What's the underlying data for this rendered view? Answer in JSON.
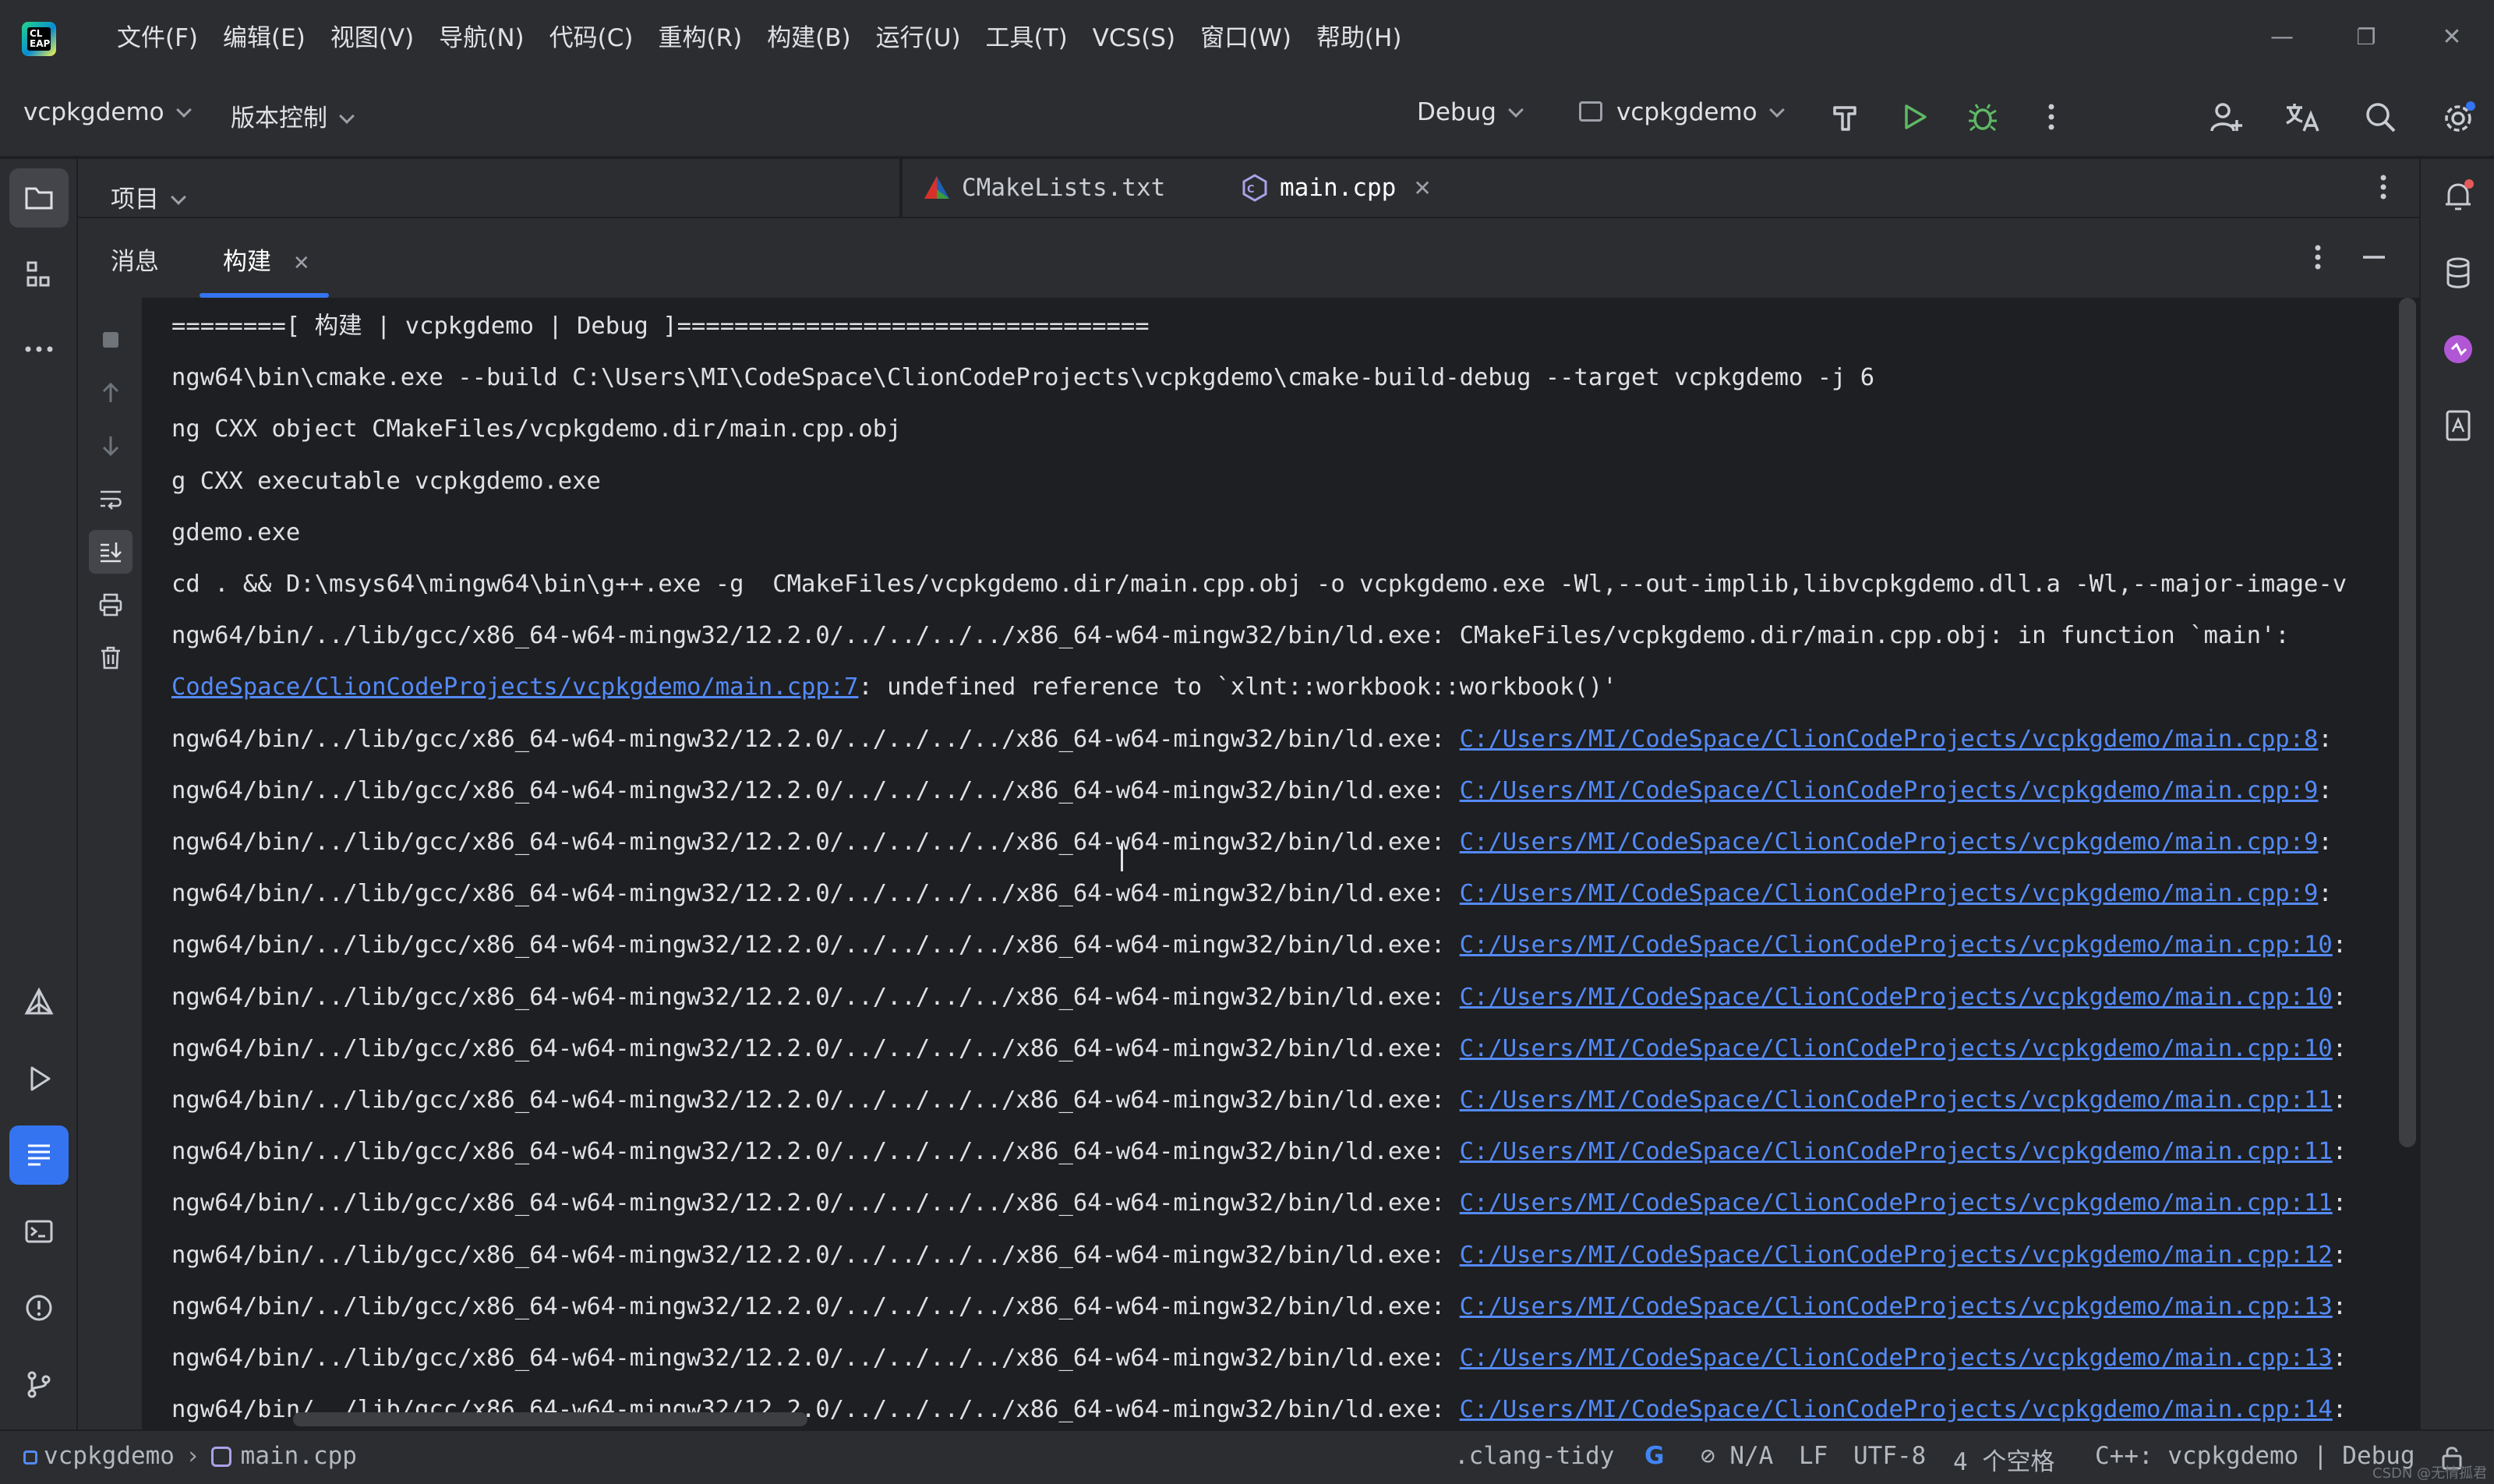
{
  "app": {
    "logo_text": "CL\nEAP"
  },
  "menu": [
    "文件(F)",
    "编辑(E)",
    "视图(V)",
    "导航(N)",
    "代码(C)",
    "重构(R)",
    "构建(B)",
    "运行(U)",
    "工具(T)",
    "VCS(S)",
    "窗口(W)",
    "帮助(H)"
  ],
  "window_controls": {
    "minimize": "—",
    "restore": "❐",
    "close": "✕"
  },
  "toolbar": {
    "project": "vcpkgdemo",
    "vcs": "版本控制",
    "config": "Debug",
    "target": "vcpkgdemo"
  },
  "project_panel": {
    "title": "项目"
  },
  "editor_tabs": [
    {
      "label": "CMakeLists.txt",
      "icon": "cmake-icon"
    },
    {
      "label": "main.cpp",
      "icon": "cpp-file-icon",
      "active": true
    }
  ],
  "build_window": {
    "tabs": [
      {
        "label": "消息"
      },
      {
        "label": "构建",
        "active": true
      }
    ]
  },
  "console": {
    "lines": [
      {
        "text": "========[ 构建 | vcpkgdemo | Debug ]================================="
      },
      {
        "text": "ngw64\\bin\\cmake.exe --build C:\\Users\\MI\\CodeSpace\\ClionCodeProjects\\vcpkgdemo\\cmake-build-debug --target vcpkgdemo -j 6"
      },
      {
        "text": "ng CXX object CMakeFiles/vcpkgdemo.dir/main.cpp.obj"
      },
      {
        "text": "g CXX executable vcpkgdemo.exe"
      },
      {
        "text": "gdemo.exe"
      },
      {
        "text": "cd . && D:\\msys64\\mingw64\\bin\\g++.exe -g  CMakeFiles/vcpkgdemo.dir/main.cpp.obj -o vcpkgdemo.exe -Wl,--out-implib,libvcpkgdemo.dll.a -Wl,--major-image-v"
      },
      {
        "text": "ngw64/bin/../lib/gcc/x86_64-w64-mingw32/12.2.0/../../../../x86_64-w64-mingw32/bin/ld.exe: CMakeFiles/vcpkgdemo.dir/main.cpp.obj: in function `main':"
      },
      {
        "text": "",
        "link": "CodeSpace/ClionCodeProjects/vcpkgdemo/main.cpp:7",
        "suffix": ": undefined reference to `xlnt::workbook::workbook()'"
      },
      {
        "text": "ngw64/bin/../lib/gcc/x86_64-w64-mingw32/12.2.0/../../../../x86_64-w64-mingw32/bin/ld.exe: ",
        "link": "C:/Users/MI/CodeSpace/ClionCodeProjects/vcpkgdemo/main.cpp:8",
        "suffix": ":"
      },
      {
        "text": "ngw64/bin/../lib/gcc/x86_64-w64-mingw32/12.2.0/../../../../x86_64-w64-mingw32/bin/ld.exe: ",
        "link": "C:/Users/MI/CodeSpace/ClionCodeProjects/vcpkgdemo/main.cpp:9",
        "suffix": ":"
      },
      {
        "text": "ngw64/bin/../lib/gcc/x86_64-w64-mingw32/12.2.0/../../../../x86_64-w64-mingw32/bin/ld.exe: ",
        "link": "C:/Users/MI/CodeSpace/ClionCodeProjects/vcpkgdemo/main.cpp:9",
        "suffix": ":"
      },
      {
        "text": "ngw64/bin/../lib/gcc/x86_64-w64-mingw32/12.2.0/../../../../x86_64-w64-mingw32/bin/ld.exe: ",
        "link": "C:/Users/MI/CodeSpace/ClionCodeProjects/vcpkgdemo/main.cpp:9",
        "suffix": ":"
      },
      {
        "text": "ngw64/bin/../lib/gcc/x86_64-w64-mingw32/12.2.0/../../../../x86_64-w64-mingw32/bin/ld.exe: ",
        "link": "C:/Users/MI/CodeSpace/ClionCodeProjects/vcpkgdemo/main.cpp:10",
        "suffix": ":"
      },
      {
        "text": "ngw64/bin/../lib/gcc/x86_64-w64-mingw32/12.2.0/../../../../x86_64-w64-mingw32/bin/ld.exe: ",
        "link": "C:/Users/MI/CodeSpace/ClionCodeProjects/vcpkgdemo/main.cpp:10",
        "suffix": ":"
      },
      {
        "text": "ngw64/bin/../lib/gcc/x86_64-w64-mingw32/12.2.0/../../../../x86_64-w64-mingw32/bin/ld.exe: ",
        "link": "C:/Users/MI/CodeSpace/ClionCodeProjects/vcpkgdemo/main.cpp:10",
        "suffix": ":"
      },
      {
        "text": "ngw64/bin/../lib/gcc/x86_64-w64-mingw32/12.2.0/../../../../x86_64-w64-mingw32/bin/ld.exe: ",
        "link": "C:/Users/MI/CodeSpace/ClionCodeProjects/vcpkgdemo/main.cpp:11",
        "suffix": ":"
      },
      {
        "text": "ngw64/bin/../lib/gcc/x86_64-w64-mingw32/12.2.0/../../../../x86_64-w64-mingw32/bin/ld.exe: ",
        "link": "C:/Users/MI/CodeSpace/ClionCodeProjects/vcpkgdemo/main.cpp:11",
        "suffix": ":"
      },
      {
        "text": "ngw64/bin/../lib/gcc/x86_64-w64-mingw32/12.2.0/../../../../x86_64-w64-mingw32/bin/ld.exe: ",
        "link": "C:/Users/MI/CodeSpace/ClionCodeProjects/vcpkgdemo/main.cpp:11",
        "suffix": ":"
      },
      {
        "text": "ngw64/bin/../lib/gcc/x86_64-w64-mingw32/12.2.0/../../../../x86_64-w64-mingw32/bin/ld.exe: ",
        "link": "C:/Users/MI/CodeSpace/ClionCodeProjects/vcpkgdemo/main.cpp:12",
        "suffix": ":"
      },
      {
        "text": "ngw64/bin/../lib/gcc/x86_64-w64-mingw32/12.2.0/../../../../x86_64-w64-mingw32/bin/ld.exe: ",
        "link": "C:/Users/MI/CodeSpace/ClionCodeProjects/vcpkgdemo/main.cpp:13",
        "suffix": ":"
      },
      {
        "text": "ngw64/bin/../lib/gcc/x86_64-w64-mingw32/12.2.0/../../../../x86_64-w64-mingw32/bin/ld.exe: ",
        "link": "C:/Users/MI/CodeSpace/ClionCodeProjects/vcpkgdemo/main.cpp:13",
        "suffix": ":"
      },
      {
        "text": "ngw64/bin/../lib/gcc/x86_64-w64-mingw32/12.2.0/../../../../x86_64-w64-mingw32/bin/ld.exe: ",
        "link": "C:/Users/MI/CodeSpace/ClionCodeProjects/vcpkgdemo/main.cpp:14",
        "suffix": ":"
      }
    ]
  },
  "statusbar": {
    "project": "vcpkgdemo",
    "file": "main.cpp",
    "clang_tidy": ".clang-tidy",
    "google": "G",
    "na": "⊘ N/A",
    "line_ending": "LF",
    "encoding": "UTF-8",
    "indent": "4 个空格",
    "context": "C++: vcpkgdemo | Debug"
  },
  "watermark": "CSDN @无情孤君",
  "colors": {
    "accent": "#3574f0",
    "link": "#548af7",
    "run_green": "#5fb865",
    "notification_red": "#e55b5b"
  }
}
